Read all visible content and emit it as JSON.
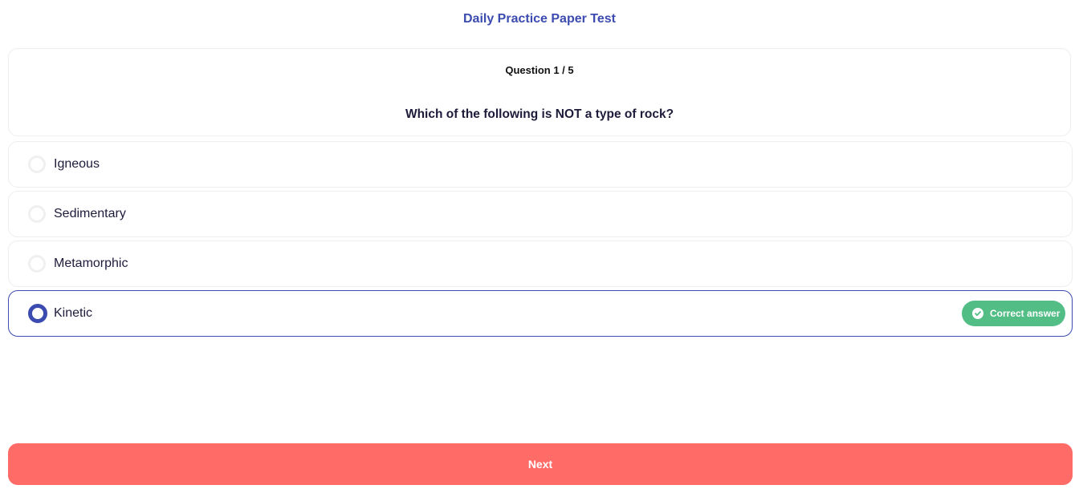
{
  "header": {
    "title": "Daily Practice Paper Test"
  },
  "question": {
    "counter": "Question 1 / 5",
    "text": "Which of the following is NOT a type of rock?"
  },
  "options": [
    {
      "label": "Igneous",
      "selected": false
    },
    {
      "label": "Sedimentary",
      "selected": false
    },
    {
      "label": "Metamorphic",
      "selected": false
    },
    {
      "label": "Kinetic",
      "selected": true
    }
  ],
  "feedback": {
    "correct_label": "Correct answer",
    "icon": "check-circle-icon"
  },
  "footer": {
    "next_label": "Next"
  },
  "colors": {
    "accent": "#3b4bb0",
    "success": "#52be86",
    "next_button": "#ff6b67"
  }
}
